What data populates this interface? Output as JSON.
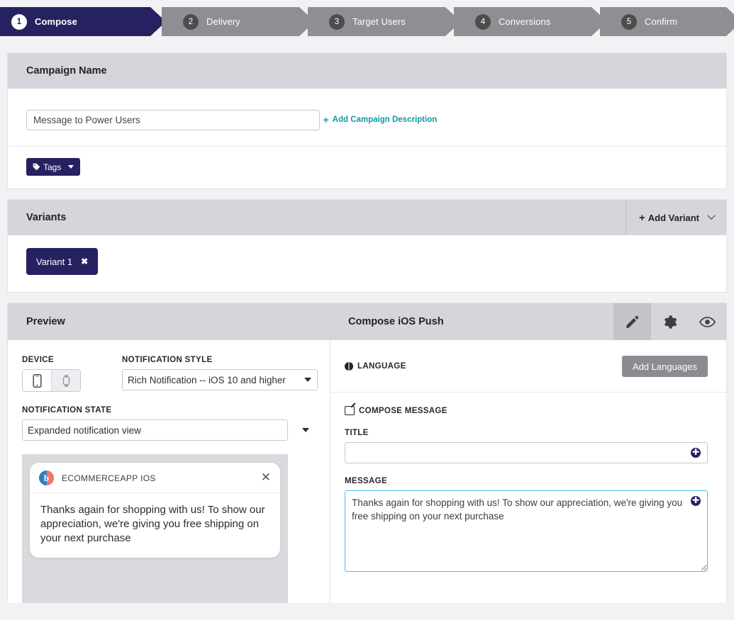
{
  "wizard": {
    "steps": [
      {
        "num": "1",
        "label": "Compose",
        "state": "active"
      },
      {
        "num": "2",
        "label": "Delivery",
        "state": "idle"
      },
      {
        "num": "3",
        "label": "Target Users",
        "state": "idle"
      },
      {
        "num": "4",
        "label": "Conversions",
        "state": "idle"
      },
      {
        "num": "5",
        "label": "Confirm",
        "state": "idle"
      }
    ],
    "active_color": "#262261",
    "idle_color": "#8e8e93"
  },
  "campaign": {
    "header": "Campaign Name",
    "name_value": "Message to Power Users",
    "name_placeholder": "Campaign Name",
    "add_description_label": "Add Campaign Description",
    "add_description_plus": "+",
    "tags_label": "Tags"
  },
  "variants": {
    "header": "Variants",
    "add_variant_label": "Add Variant",
    "add_variant_plus": "+",
    "chips": [
      {
        "label": "Variant 1",
        "close": "✖"
      }
    ]
  },
  "compose": {
    "preview_title": "Preview",
    "compose_title": "Compose iOS Push",
    "icons": [
      {
        "name": "pencil-icon",
        "active": true
      },
      {
        "name": "gear-icon",
        "active": false
      },
      {
        "name": "eye-icon",
        "active": false
      }
    ]
  },
  "preview": {
    "device_label": "DEVICE",
    "device_options": [
      "phone",
      "watch"
    ],
    "device_selected": "phone",
    "notification_style_label": "NOTIFICATION STYLE",
    "notification_style_value": "Rich Notification -- iOS 10 and higher",
    "notification_state_label": "NOTIFICATION STATE",
    "notification_state_value": "Expanded notification view",
    "notification": {
      "app_name": "ECOMMERCEAPP IOS",
      "close": "✕",
      "body": "Thanks again for shopping with us! To show our appreciation, we're giving you free shipping on your next purchase"
    }
  },
  "message_editor": {
    "language_label": "LANGUAGE",
    "add_languages_label": "Add Languages",
    "compose_message_label": "COMPOSE MESSAGE",
    "title_label": "TITLE",
    "title_value": "",
    "title_placeholder": "",
    "message_label": "MESSAGE",
    "message_value": "Thanks again for shopping with us! To show our appreciation, we're giving you free shipping on your next purchase",
    "message_placeholder": "",
    "insert_symbol": "✚"
  },
  "colors": {
    "brand_navy": "#262261",
    "teal_link": "#0a9ba6",
    "focus_blue": "#3fc3e8",
    "header_grey": "#d5d5db"
  }
}
